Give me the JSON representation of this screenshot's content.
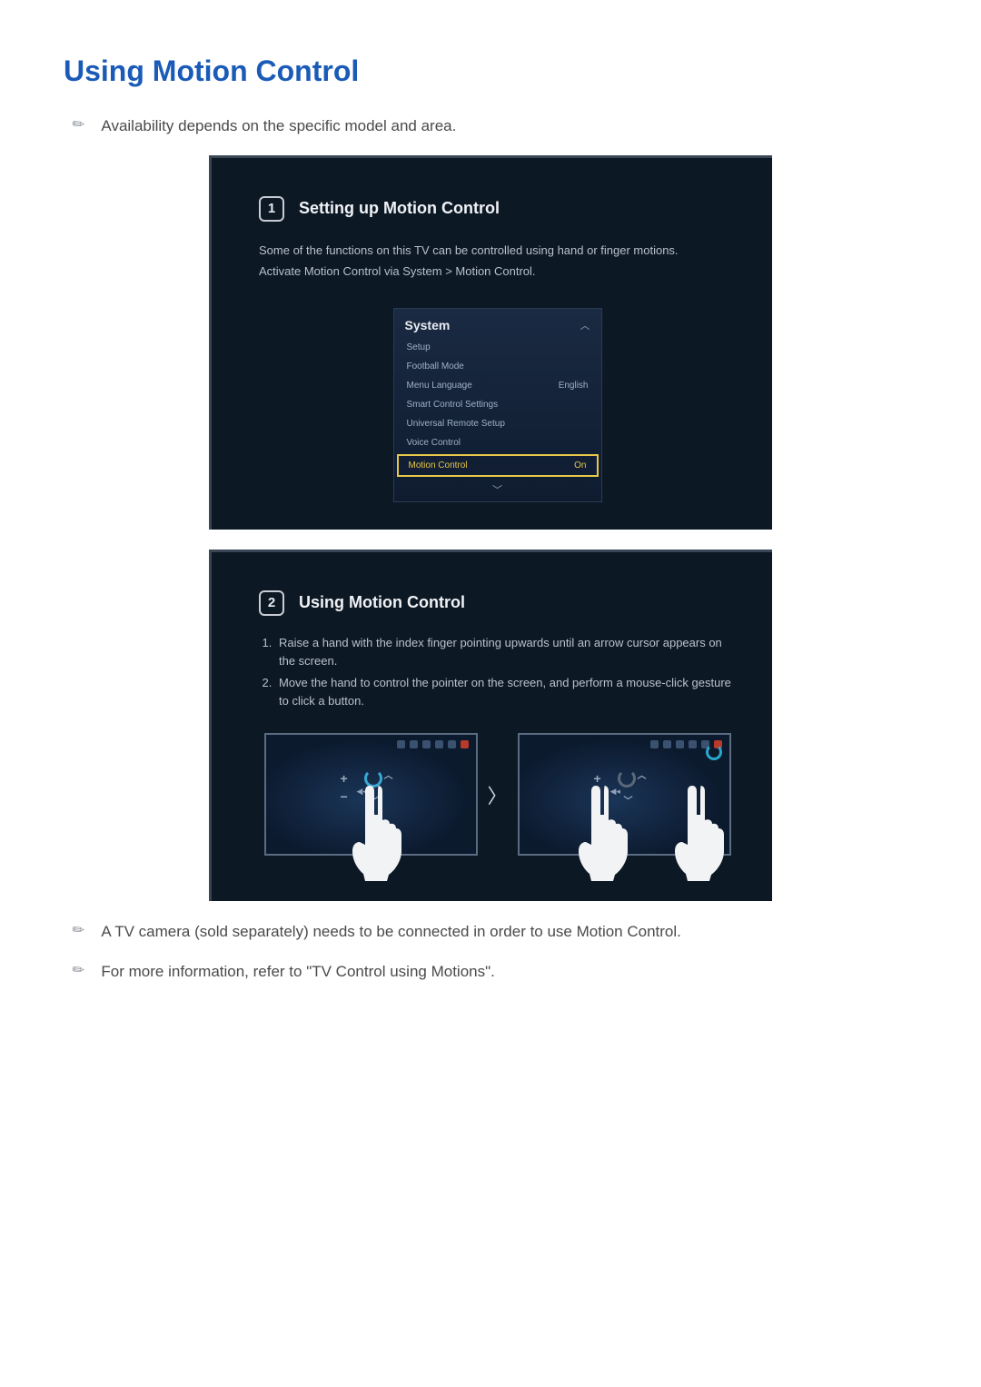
{
  "title": "Using Motion Control",
  "notes": {
    "top": "Availability depends on the specific model and area.",
    "bottom1": "A TV camera (sold separately) needs to be connected in order to use Motion Control.",
    "bottom2": "For more information, refer to \"TV Control using Motions\"."
  },
  "step1": {
    "num": "1",
    "title": "Setting up Motion Control",
    "desc1": "Some of the functions on this TV can be controlled using hand or finger motions.",
    "desc2": "Activate Motion Control via System > Motion Control.",
    "menu": {
      "title": "System",
      "items": [
        {
          "label": "Setup",
          "value": ""
        },
        {
          "label": "Football Mode",
          "value": ""
        },
        {
          "label": "Menu Language",
          "value": "English"
        },
        {
          "label": "Smart Control Settings",
          "value": ""
        },
        {
          "label": "Universal Remote Setup",
          "value": ""
        },
        {
          "label": "Voice Control",
          "value": ""
        }
      ],
      "highlight": {
        "label": "Motion Control",
        "value": "On"
      }
    }
  },
  "step2": {
    "num": "2",
    "title": "Using Motion Control",
    "list": [
      "Raise a hand with the index finger pointing upwards until an arrow cursor appears on the screen.",
      "Move the hand to control the pointer on the screen, and perform a mouse-click gesture to click a button."
    ]
  }
}
